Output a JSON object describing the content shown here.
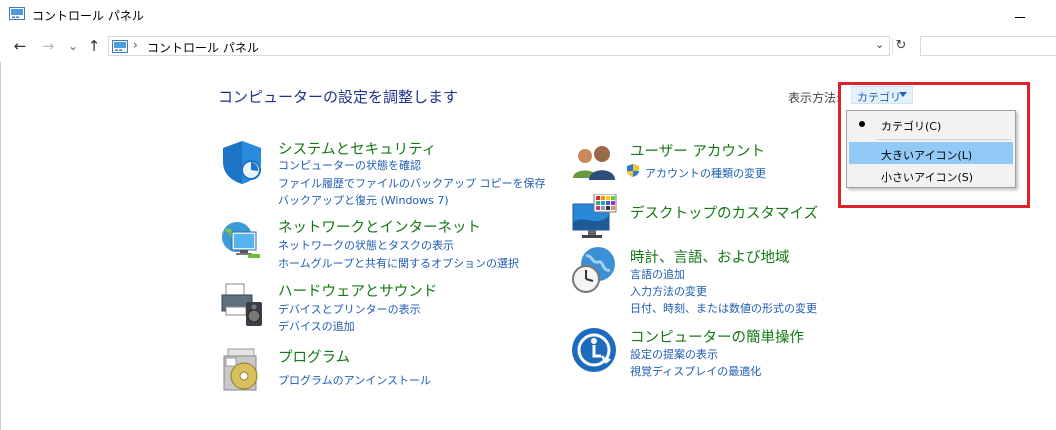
{
  "window": {
    "title": "コントロール パネル"
  },
  "nav": {
    "back": "←",
    "forward": "→",
    "recent": "⌄",
    "up": "↑",
    "breadcrumb_separator": "›",
    "breadcrumb": "コントロール パネル",
    "address_dropdown": "⌄",
    "refresh": "↻"
  },
  "main": {
    "heading": "コンピューターの設定を調整します",
    "view_by_label": "表示方法:",
    "view_by_value": "カテゴリ"
  },
  "view_menu": {
    "items": [
      {
        "label": "カテゴリ(C)",
        "selected": true
      },
      {
        "label": "大きいアイコン(L)",
        "hovered": true
      },
      {
        "label": "小さいアイコン(S)"
      }
    ]
  },
  "categories": {
    "system": {
      "icon": "shield-icon",
      "title": "システムとセキュリティ",
      "links": [
        "コンピューターの状態を確認",
        "ファイル履歴でファイルのバックアップ コピーを保存",
        "バックアップと復元 (Windows 7)"
      ]
    },
    "network": {
      "icon": "network-globe-icon",
      "title": "ネットワークとインターネット",
      "links": [
        "ネットワークの状態とタスクの表示",
        "ホームグループと共有に関するオプションの選択"
      ]
    },
    "hardware": {
      "icon": "printer-speaker-icon",
      "title": "ハードウェアとサウンド",
      "links": [
        "デバイスとプリンターの表示",
        "デバイスの追加"
      ]
    },
    "programs": {
      "icon": "programs-disc-icon",
      "title": "プログラム",
      "links": [
        "プログラムのアンインストール"
      ]
    },
    "users": {
      "icon": "users-icon",
      "title": "ユーザー アカウント",
      "links": [
        "アカウントの種類の変更"
      ]
    },
    "appearance": {
      "icon": "monitor-palette-icon",
      "title": "デスクトップのカスタマイズ",
      "links": []
    },
    "clock": {
      "icon": "clock-globe-icon",
      "title": "時計、言語、および地域",
      "links": [
        "言語の追加",
        "入力方法の変更",
        "日付、時刻、または数値の形式の変更"
      ]
    },
    "ease": {
      "icon": "ease-of-access-icon",
      "title": "コンピューターの簡単操作",
      "links": [
        "設定の提案の表示",
        "視覚ディスプレイの最適化"
      ]
    }
  },
  "colors": {
    "category_title": "#147814",
    "link": "#1e5cb3",
    "heading": "#1e3287",
    "menu_highlight": "#91c9f7",
    "annotation_red": "#e0202c"
  }
}
